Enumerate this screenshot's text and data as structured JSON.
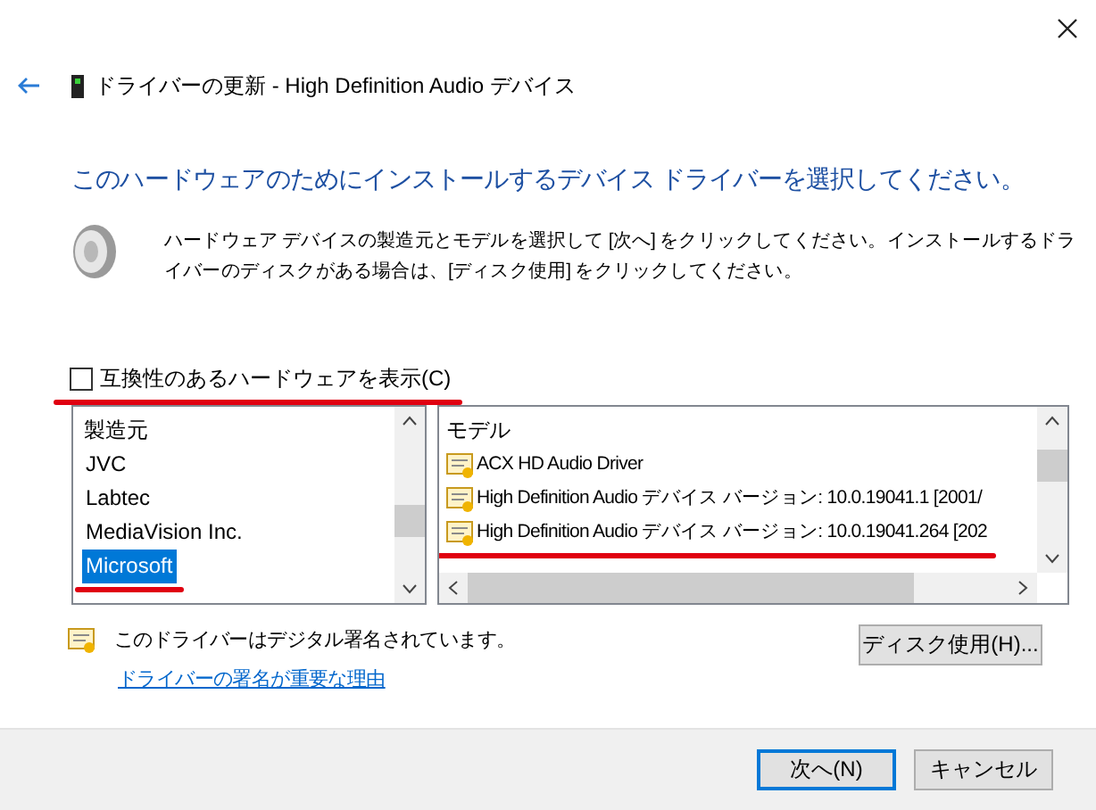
{
  "header": {
    "title": "ドライバーの更新 - High Definition Audio デバイス"
  },
  "heading": "このハードウェアのためにインストールするデバイス ドライバーを選択してください。",
  "description": "ハードウェア デバイスの製造元とモデルを選択して [次へ] をクリックしてください。インストールするドライバーのディスクがある場合は、[ディスク使用] をクリックしてください。",
  "compatible_checkbox": {
    "label": "互換性のあるハードウェアを表示(C)",
    "checked": false,
    "underlined": true
  },
  "manufacturers": {
    "header": "製造元",
    "items": [
      {
        "label": "JVC",
        "selected": false,
        "underlined": false
      },
      {
        "label": "Labtec",
        "selected": false,
        "underlined": false
      },
      {
        "label": "MediaVision Inc.",
        "selected": false,
        "underlined": false
      },
      {
        "label": "Microsoft",
        "selected": true,
        "underlined": true
      }
    ]
  },
  "models": {
    "header": "モデル",
    "items": [
      {
        "label": "ACX HD Audio Driver",
        "selected": false,
        "underlined": false
      },
      {
        "label": "High Definition Audio デバイス バージョン: 10.0.19041.1 [2001/",
        "selected": false,
        "underlined": false
      },
      {
        "label": "High Definition Audio デバイス バージョン: 10.0.19041.264 [202",
        "selected": false,
        "underlined": true
      }
    ]
  },
  "signature": {
    "text": "このドライバーはデジタル署名されています。",
    "link": "ドライバーの署名が重要な理由"
  },
  "disk_button": "ディスク使用(H)...",
  "footer_buttons": [
    {
      "label": "次へ(N)",
      "default": true
    },
    {
      "label": "キャンセル",
      "default": false
    }
  ]
}
